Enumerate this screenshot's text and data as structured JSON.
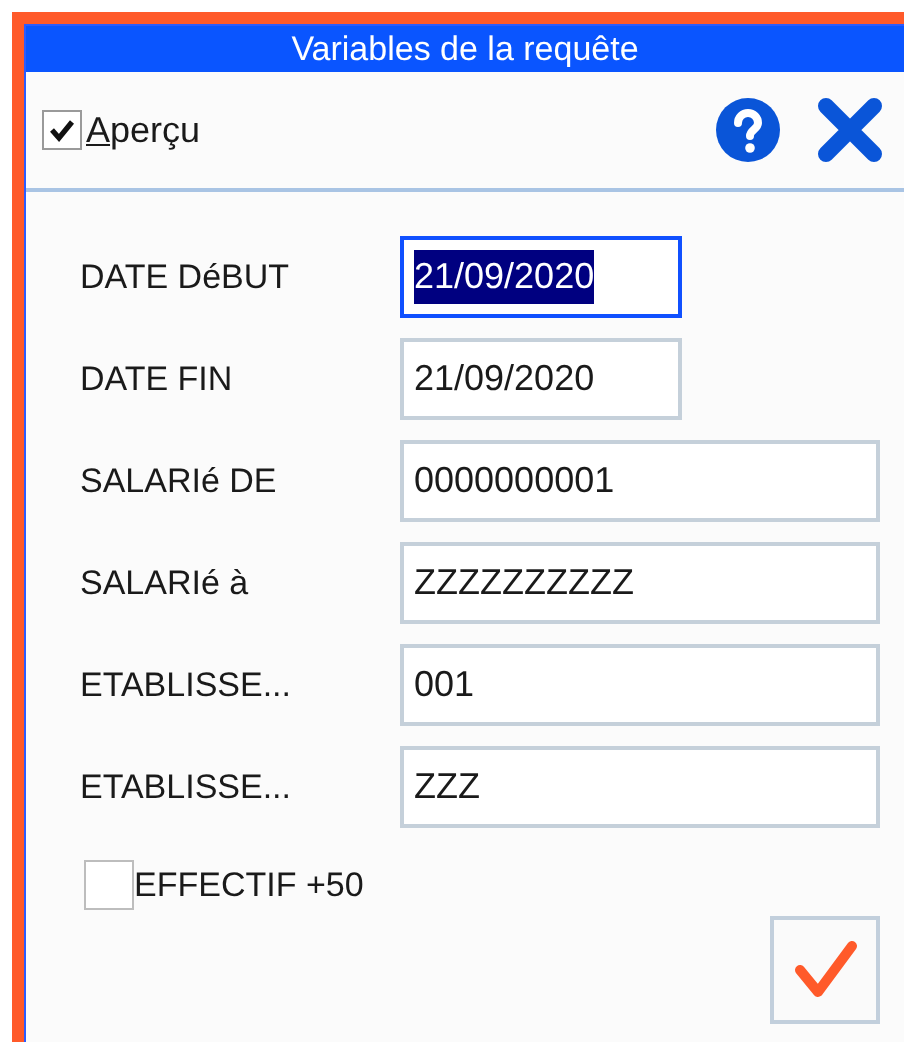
{
  "window": {
    "title": "Variables de la requête"
  },
  "toolbar": {
    "preview": {
      "label": "Aperçu",
      "checked": true
    }
  },
  "fields": [
    {
      "label": "DATE DéBUT",
      "value": "21/09/2020",
      "kind": "date",
      "focused": true
    },
    {
      "label": "DATE FIN",
      "value": "21/09/2020",
      "kind": "date",
      "focused": false
    },
    {
      "label": "SALARIé DE",
      "value": "0000000001",
      "kind": "text",
      "focused": false
    },
    {
      "label": "SALARIé à",
      "value": "ZZZZZZZZZZ",
      "kind": "text",
      "focused": false
    },
    {
      "label": "ETABLISSE...",
      "value": "001",
      "kind": "text",
      "focused": false
    },
    {
      "label": "ETABLISSE...",
      "value": "ZZZ",
      "kind": "text",
      "focused": false
    }
  ],
  "option": {
    "label": "EFFECTIF +50",
    "checked": false
  }
}
